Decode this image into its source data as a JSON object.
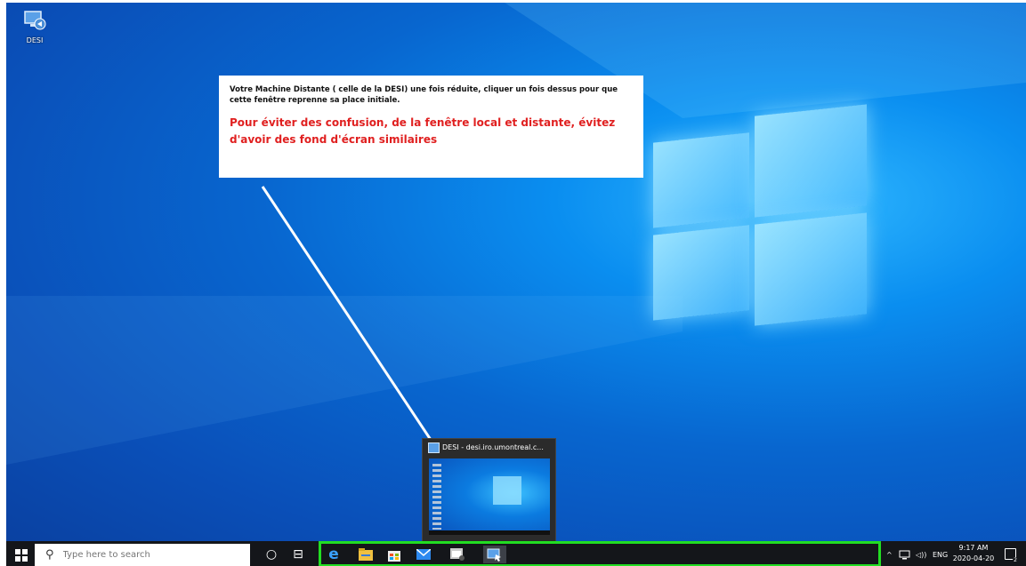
{
  "desktop": {
    "icon_label": "DESI"
  },
  "callout": {
    "instruction": "Votre Machine Distante  ( celle de la DESI) une fois réduite, cliquer un fois dessus pour que cette fenêtre reprenne sa place initiale.",
    "warning": "Pour éviter des confusion, de la fenêtre local et distante, évitez d'avoir des fond d'écran similaires"
  },
  "thumbnail": {
    "title": "DESI - desi.iro.umontreal.c..."
  },
  "taskbar": {
    "search_placeholder": "Type here to search",
    "language": "ENG",
    "time": "9:17 AM",
    "date": "2020-04-20",
    "notification_count": "2"
  },
  "colors": {
    "highlight": "#22dd22",
    "warning_text": "#e02020",
    "taskbar": "#14161a"
  }
}
